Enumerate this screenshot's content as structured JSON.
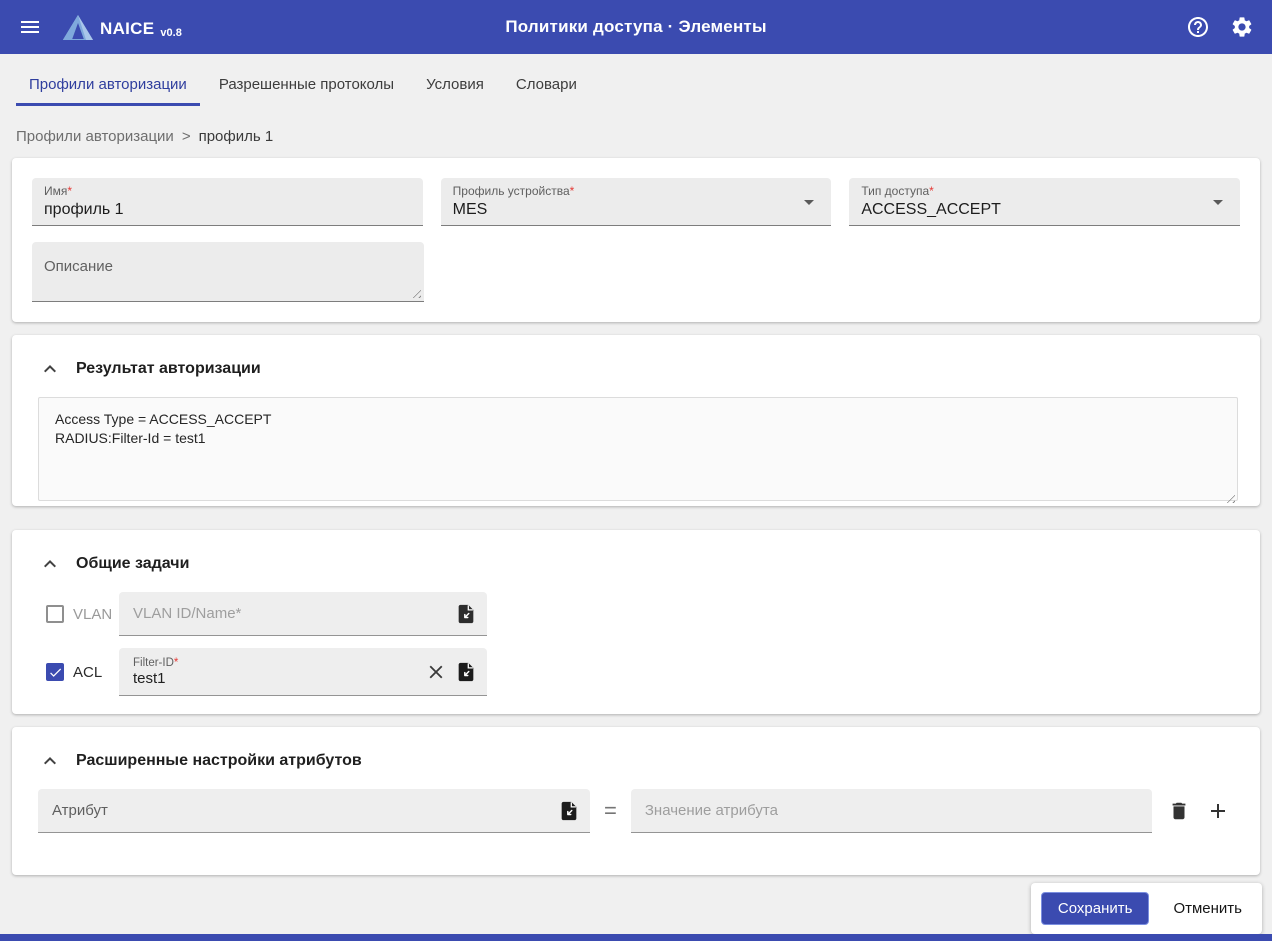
{
  "appbar": {
    "brand": "NAICE",
    "version": "v0.8",
    "title": "Политики доступа · Элементы"
  },
  "tabs": [
    "Профили авторизации",
    "Разрешенные протоколы",
    "Условия",
    "Словари"
  ],
  "breadcrumb": {
    "root": "Профили авторизации",
    "separator": ">",
    "current": "профиль 1"
  },
  "form": {
    "name_label": "Имя",
    "name_required": "*",
    "name_value": "профиль 1",
    "device_label": "Профиль устройства",
    "device_required": "*",
    "device_value": "MES",
    "access_label": "Тип доступа",
    "access_required": "*",
    "access_value": "ACCESS_ACCEPT",
    "description_label": "Описание"
  },
  "auth_result": {
    "title": "Результат авторизации",
    "content": "Access Type = ACCESS_ACCEPT\nRADIUS:Filter-Id = test1"
  },
  "common_tasks": {
    "title": "Общие задачи",
    "vlan_label": "VLAN",
    "vlan_placeholder": "VLAN ID/Name*",
    "acl_label": "ACL",
    "acl_field_label": "Filter-ID",
    "acl_field_required": "*",
    "acl_value": "test1"
  },
  "advanced": {
    "title": "Расширенные настройки атрибутов",
    "attribute_placeholder": "Атрибут",
    "equals": "=",
    "value_placeholder": "Значение атрибута"
  },
  "actions": {
    "save": "Сохранить",
    "cancel": "Отменить"
  },
  "colors": {
    "primary": "#3b4bb0",
    "required": "#e53935"
  }
}
